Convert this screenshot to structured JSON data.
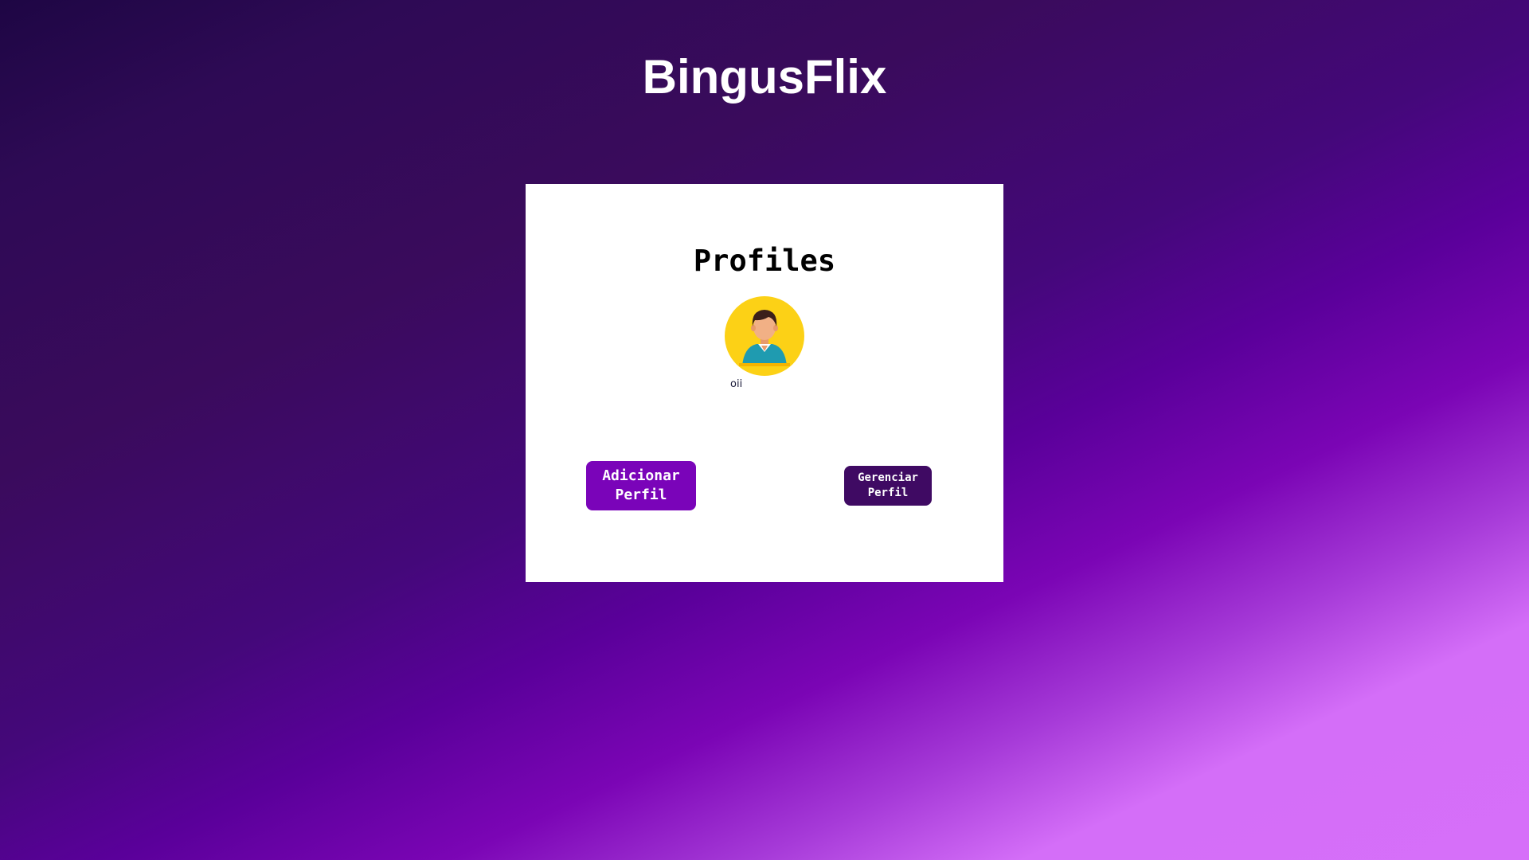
{
  "header": {
    "app_title": "BingusFlix"
  },
  "profiles_panel": {
    "title": "Profiles",
    "profiles": [
      {
        "name": "oii",
        "avatar_icon": "person-avatar-icon"
      }
    ],
    "add_profile_label": "Adicionar Perfil",
    "manage_profile_label": "Gerenciar Perfil"
  },
  "colors": {
    "avatar_background": "#fcd116",
    "add_button": "#7a04b9",
    "manage_button": "#3f0a63",
    "card_background": "#ffffff"
  }
}
